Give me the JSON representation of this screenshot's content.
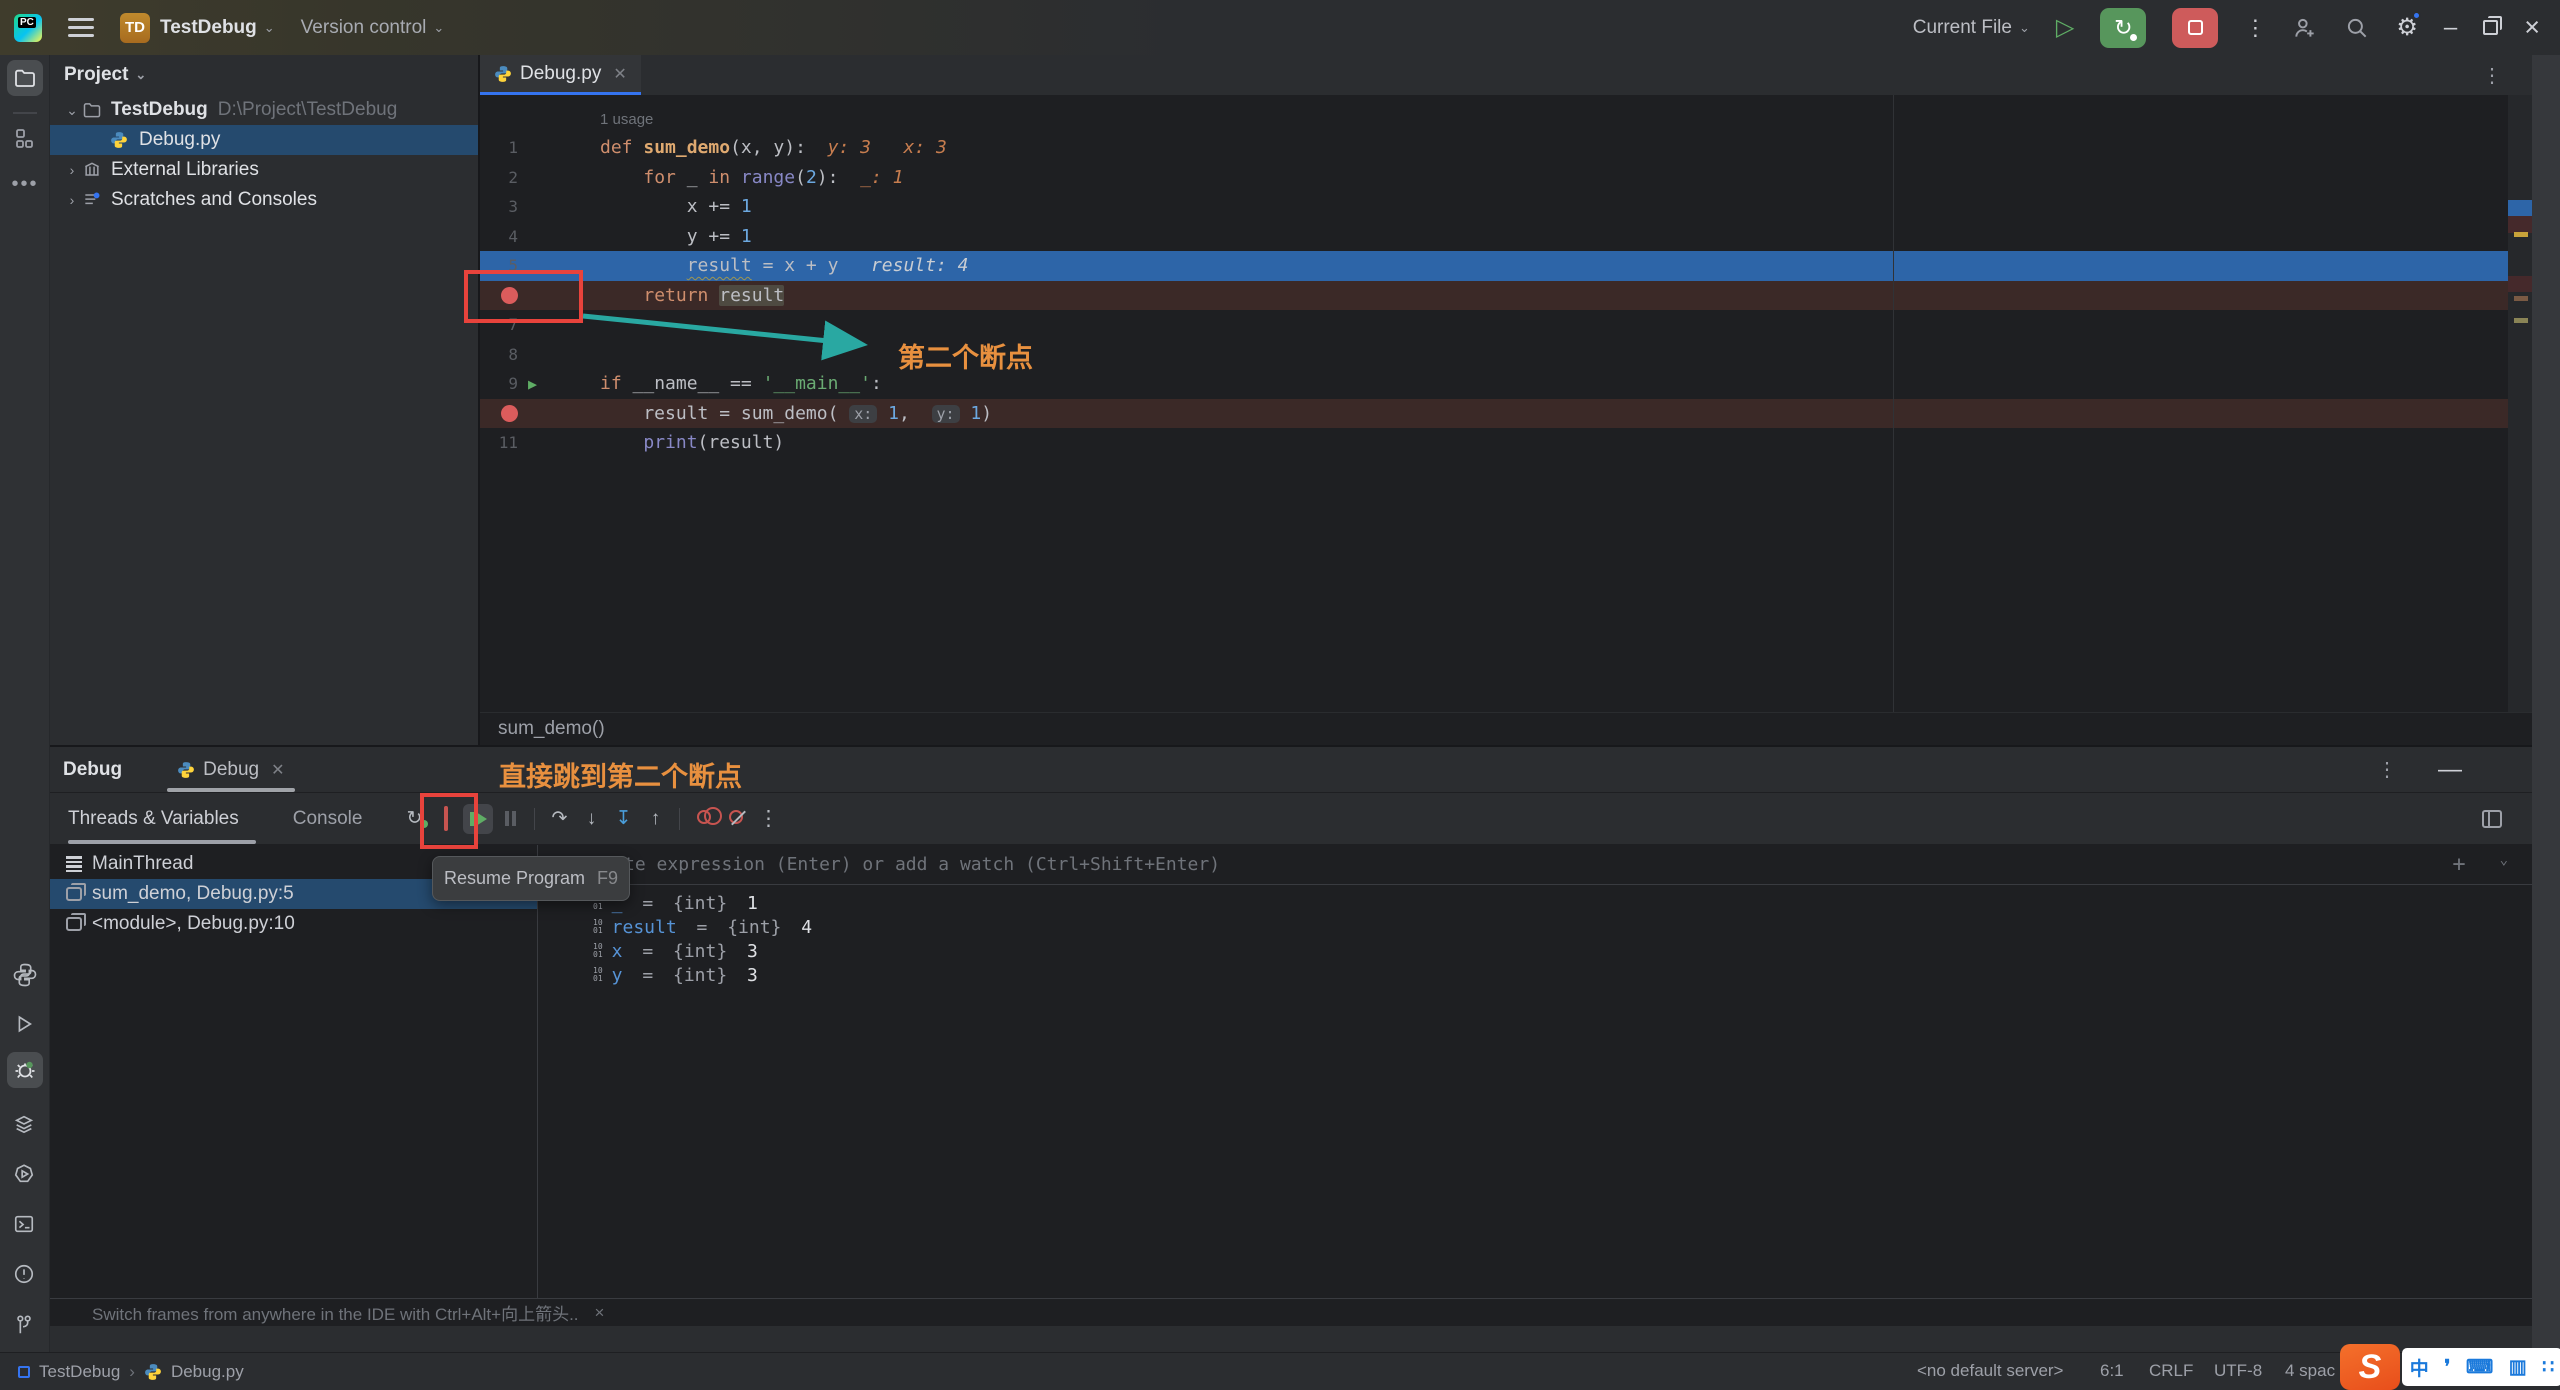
{
  "colors": {
    "accent_blue": "#3574F0",
    "execution_line": "#2D65A8",
    "breakpoint_line": "#3B2927",
    "breakpoint_dot": "#DB5C5C",
    "selection": "#254A6E",
    "annotation_red": "#E8433C",
    "annotation_teal": "#29A8A2",
    "annotation_orange": "#E8903F"
  },
  "title_bar": {
    "logo": "PC",
    "project_badge": "TD",
    "project_name": "TestDebug",
    "version_control": "Version control",
    "run_config": "Current File"
  },
  "project_panel": {
    "header": "Project",
    "items": [
      {
        "label": "TestDebug",
        "path": "D:\\Project\\TestDebug",
        "icon": "folder",
        "chevron": "expanded",
        "indent": 0,
        "selected": false
      },
      {
        "label": "Debug.py",
        "path": "",
        "icon": "python",
        "chevron": "",
        "indent": 1,
        "selected": true
      },
      {
        "label": "External Libraries",
        "path": "",
        "icon": "library",
        "chevron": "collapsed",
        "indent": 0,
        "selected": false
      },
      {
        "label": "Scratches and Consoles",
        "path": "",
        "icon": "scratch",
        "chevron": "collapsed",
        "indent": 0,
        "selected": false
      }
    ]
  },
  "editor": {
    "tab": {
      "label": "Debug.py"
    },
    "usage_label": "1 usage",
    "inspection": {
      "warnings": "1",
      "weak_warnings": "2"
    },
    "breadcrumb": "sum_demo()",
    "code_lines": [
      {
        "num": "1",
        "gutter": "num",
        "row": "",
        "tokens": [
          {
            "c": "kw",
            "t": "def "
          },
          {
            "c": "fn",
            "t": "sum_demo"
          },
          {
            "c": "txt",
            "t": "(x, y):"
          },
          {
            "c": "txt",
            "t": "  "
          },
          {
            "c": "hintO",
            "t": "y: 3"
          },
          {
            "c": "txt",
            "t": "   "
          },
          {
            "c": "hintO",
            "t": "x: 3"
          }
        ]
      },
      {
        "num": "2",
        "gutter": "num",
        "row": "",
        "tokens": [
          {
            "c": "txt",
            "t": "    "
          },
          {
            "c": "kw",
            "t": "for"
          },
          {
            "c": "txt",
            "t": " _ "
          },
          {
            "c": "kw",
            "t": "in"
          },
          {
            "c": "txt",
            "t": " "
          },
          {
            "c": "call",
            "t": "range"
          },
          {
            "c": "txt",
            "t": "("
          },
          {
            "c": "num",
            "t": "2"
          },
          {
            "c": "txt",
            "t": "):  "
          },
          {
            "c": "hintO",
            "t": "_: 1"
          }
        ]
      },
      {
        "num": "3",
        "gutter": "num",
        "row": "",
        "tokens": [
          {
            "c": "txt",
            "t": "        x += "
          },
          {
            "c": "num",
            "t": "1"
          }
        ]
      },
      {
        "num": "4",
        "gutter": "num",
        "row": "",
        "tokens": [
          {
            "c": "txt",
            "t": "        y += "
          },
          {
            "c": "num",
            "t": "1"
          }
        ]
      },
      {
        "num": "5",
        "gutter": "num",
        "row": "exec",
        "tokens": [
          {
            "c": "txt",
            "t": "        "
          },
          {
            "c": "und",
            "t": "result"
          },
          {
            "c": "txt",
            "t": " = x + y"
          },
          {
            "c": "txt",
            "t": "   "
          },
          {
            "c": "hintW",
            "t": "result: 4"
          }
        ]
      },
      {
        "num": "6",
        "gutter": "bp",
        "row": "bp",
        "tokens": [
          {
            "c": "txt",
            "t": "    "
          },
          {
            "c": "kw",
            "t": "return"
          },
          {
            "c": "txt",
            "t": " "
          },
          {
            "c": "hl",
            "t": "result"
          }
        ]
      },
      {
        "num": "7",
        "gutter": "num",
        "row": "",
        "tokens": []
      },
      {
        "num": "8",
        "gutter": "num",
        "row": "",
        "tokens": []
      },
      {
        "num": "9",
        "gutter": "num-run",
        "row": "",
        "tokens": [
          {
            "c": "kw",
            "t": "if"
          },
          {
            "c": "txt",
            "t": " __name__ == "
          },
          {
            "c": "str",
            "t": "'__main__'"
          },
          {
            "c": "txt",
            "t": ":"
          }
        ]
      },
      {
        "num": "10",
        "gutter": "bp",
        "row": "bp",
        "tokens": [
          {
            "c": "txt",
            "t": "    result = sum_demo( "
          },
          {
            "c": "chip",
            "t": "x:"
          },
          {
            "c": "txt",
            "t": " "
          },
          {
            "c": "num",
            "t": "1"
          },
          {
            "c": "txt",
            "t": ",  "
          },
          {
            "c": "chip",
            "t": "y:"
          },
          {
            "c": "txt",
            "t": " "
          },
          {
            "c": "num",
            "t": "1"
          },
          {
            "c": "txt",
            "t": ")"
          }
        ]
      },
      {
        "num": "11",
        "gutter": "num",
        "row": "",
        "tokens": [
          {
            "c": "txt",
            "t": "    "
          },
          {
            "c": "call",
            "t": "print"
          },
          {
            "c": "txt",
            "t": "(result)"
          }
        ]
      }
    ]
  },
  "annotations": {
    "editor_label": "第二个断点",
    "debug_label": "直接跳到第二个断点"
  },
  "debug_panel": {
    "title": "Debug",
    "session_tab": "Debug",
    "tabs": [
      "Threads & Variables",
      "Console"
    ],
    "toolbar_icons": [
      "rerun-debug",
      "stop",
      "resume-program",
      "pause-program",
      "separator",
      "step-over",
      "step-into",
      "force-step-into",
      "step-out",
      "separator",
      "view-breakpoints",
      "mute-breakpoints",
      "more"
    ],
    "tooltip": {
      "label": "Resume Program",
      "shortcut": "F9"
    },
    "thread": "MainThread",
    "frames": [
      {
        "label": "sum_demo, Debug.py:5",
        "selected": true
      },
      {
        "label": "<module>, Debug.py:10",
        "selected": false
      }
    ],
    "evaluate_placeholder": "Evaluate expression (Enter) or add a watch (Ctrl+Shift+Enter)",
    "variables": [
      {
        "name": "_",
        "eq": " = ",
        "type": "{int} ",
        "value": "1"
      },
      {
        "name": "result",
        "eq": " = ",
        "type": "{int} ",
        "value": "4"
      },
      {
        "name": "x",
        "eq": " = ",
        "type": "{int} ",
        "value": "3"
      },
      {
        "name": "y",
        "eq": " = ",
        "type": "{int} ",
        "value": "3"
      }
    ],
    "hint": "Switch frames from anywhere in the IDE with Ctrl+Alt+向上箭头..",
    "hint_close": "×"
  },
  "status_bar": {
    "project": "TestDebug",
    "file": "Debug.py",
    "server": "<no default server>",
    "position": "6:1",
    "line_ending": "CRLF",
    "encoding": "UTF-8",
    "indent": "4 spac",
    "ime_icons": [
      "中",
      "❜",
      "⌨",
      "▥",
      "∷"
    ]
  },
  "left_stripe": {
    "top": [
      "folder",
      "structure",
      "more"
    ],
    "bottom": [
      "python-packages",
      "run",
      "debug",
      "services",
      "python-console",
      "terminal",
      "problems",
      "git"
    ]
  },
  "right_stripe": [
    "notifications",
    "database",
    "ai-chart"
  ]
}
